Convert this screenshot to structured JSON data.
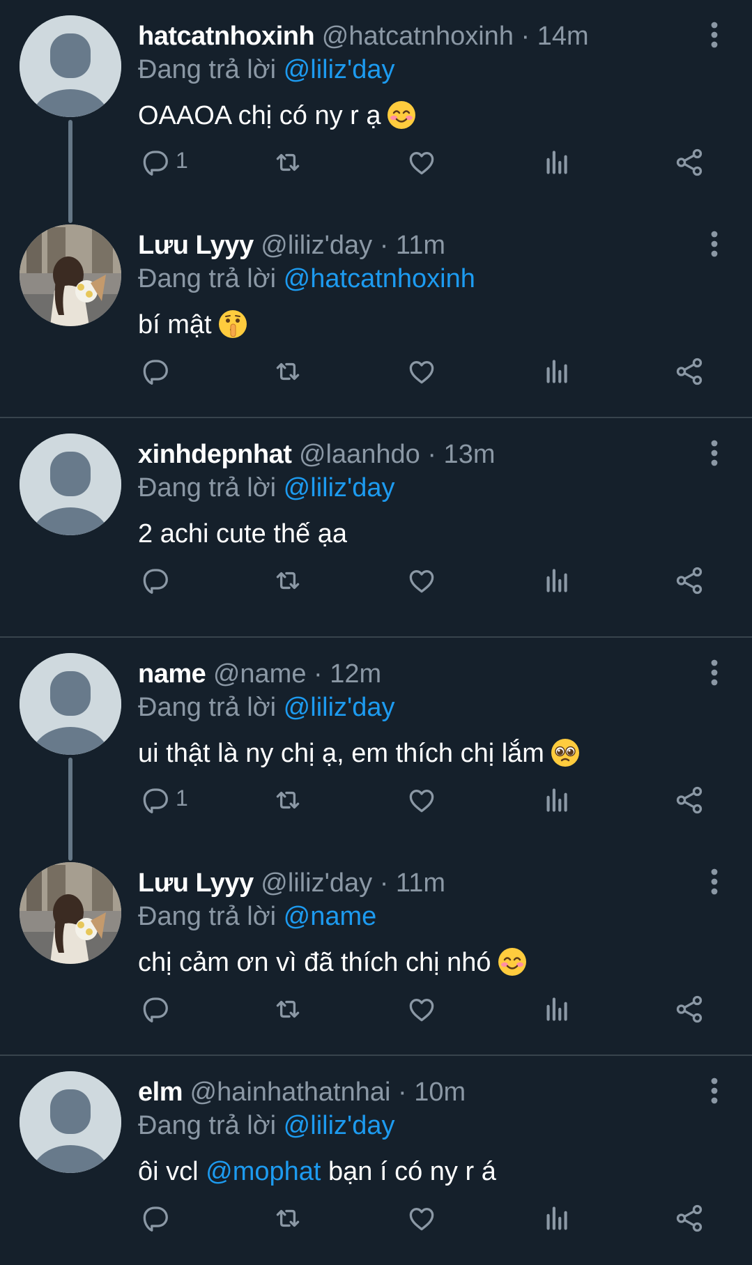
{
  "tweets": [
    {
      "display_name": "hatcatnhoxinh",
      "handle": "@hatcatnhoxinh",
      "time": "· 14m",
      "reply_prefix": "Đang trả lời",
      "reply_to": "@liliz'day",
      "text": "OAAOA chị có ny r ạ",
      "text_mention": "",
      "text_after": "",
      "emoji": "smiling-face-with-smiling-eyes",
      "avatar": "default-avatar",
      "reply_count": "1"
    },
    {
      "display_name": "Lưu Lyyy",
      "handle": "@liliz'day",
      "time": "· 11m",
      "reply_prefix": "Đang trả lời",
      "reply_to": "@hatcatnhoxinh",
      "text": "bí mật",
      "text_mention": "",
      "text_after": "",
      "emoji": "shushing-face",
      "avatar": "photo-avatar",
      "reply_count": ""
    },
    {
      "display_name": "xinhdepnhat",
      "handle": "@laanhdo",
      "time": "· 13m",
      "reply_prefix": "Đang trả lời",
      "reply_to": "@liliz'day",
      "text": "2 achi cute thế ạa",
      "text_mention": "",
      "text_after": "",
      "emoji": "",
      "avatar": "default-avatar",
      "reply_count": ""
    },
    {
      "display_name": "name",
      "handle": "@name",
      "time": "· 12m",
      "reply_prefix": "Đang trả lời",
      "reply_to": "@liliz'day",
      "text": "ui thật là ny chị ạ, em thích chị lắm",
      "text_mention": "",
      "text_after": "",
      "emoji": "pleading-face",
      "avatar": "default-avatar",
      "reply_count": "1"
    },
    {
      "display_name": "Lưu Lyyy",
      "handle": "@liliz'day",
      "time": "· 11m",
      "reply_prefix": "Đang trả lời",
      "reply_to": "@name",
      "text": "chị cảm ơn vì đã thích chị nhó",
      "text_mention": "",
      "text_after": "",
      "emoji": "smiling-face",
      "avatar": "photo-avatar",
      "reply_count": ""
    },
    {
      "display_name": "elm",
      "handle": "@hainhathatnhai",
      "time": "· 10m",
      "reply_prefix": "Đang trả lời",
      "reply_to": "@liliz'day",
      "text": "ôi vcl ",
      "text_mention": "@mophat",
      "text_after": " bạn í có ny r á",
      "emoji": "",
      "avatar": "default-avatar",
      "reply_count": ""
    }
  ],
  "icons": {
    "reply": "reply-icon",
    "retweet": "retweet-icon",
    "like": "like-icon",
    "views": "views-icon",
    "share": "share-icon",
    "more": "more-icon"
  },
  "colors": {
    "background": "#15202b",
    "name": "#ffffff",
    "meta": "#8b98a5",
    "mention": "#1d9bf0",
    "divider": "#38444d",
    "icon": "#8b98a5"
  }
}
